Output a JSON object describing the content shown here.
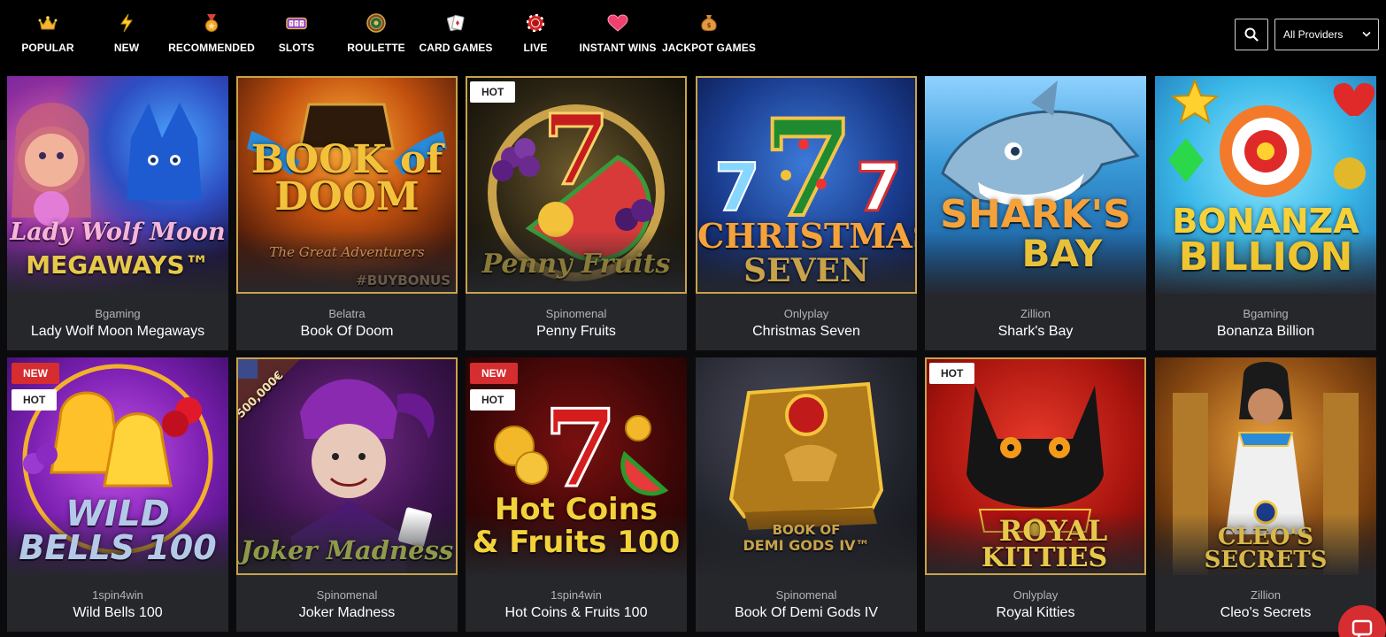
{
  "nav": {
    "items": [
      {
        "label": "POPULAR",
        "icon": "crown-icon"
      },
      {
        "label": "NEW",
        "icon": "lightning-icon"
      },
      {
        "label": "RECOMMENDED",
        "icon": "medal-icon"
      },
      {
        "label": "SLOTS",
        "icon": "slot-machine-icon"
      },
      {
        "label": "ROULETTE",
        "icon": "roulette-icon"
      },
      {
        "label": "CARD GAMES",
        "icon": "cards-icon"
      },
      {
        "label": "LIVE",
        "icon": "chip-icon"
      },
      {
        "label": "INSTANT WINS",
        "icon": "heart-icon"
      },
      {
        "label": "JACKPOT GAMES",
        "icon": "money-bag-icon"
      }
    ]
  },
  "filter": {
    "provider_selected": "All Providers"
  },
  "games": [
    {
      "provider": "Bgaming",
      "title": "Lady Wolf Moon Megaways",
      "art_line1": "Lady Wolf Moon",
      "art_line2": "MEGAWAYS™",
      "badges": []
    },
    {
      "provider": "Belatra",
      "title": "Book Of Doom",
      "art_line1": "BOOK of DOOM",
      "art_line2": "The Great Adventurers",
      "art_line3": "#BUYBONUS",
      "badges": []
    },
    {
      "provider": "Spinomenal",
      "title": "Penny Fruits",
      "art_line1": "Penny Fruits",
      "badges": [
        "HOT"
      ]
    },
    {
      "provider": "Onlyplay",
      "title": "Christmas Seven",
      "art_line1": "CHRISTMAS",
      "art_line2": "SEVEN",
      "badges": []
    },
    {
      "provider": "Zillion",
      "title": "Shark's Bay",
      "art_line1": "SHARK'S",
      "art_line2": "BAY",
      "badges": []
    },
    {
      "provider": "Bgaming",
      "title": "Bonanza Billion",
      "art_line1": "BONANZA",
      "art_line2": "BILLION",
      "badges": []
    },
    {
      "provider": "1spin4win",
      "title": "Wild Bells 100",
      "art_line1": "WILD",
      "art_line2": "BELLS 100",
      "badges": [
        "NEW",
        "HOT"
      ]
    },
    {
      "provider": "Spinomenal",
      "title": "Joker Madness",
      "art_line1": "Joker Madness",
      "art_line2": "500,000€",
      "badges": []
    },
    {
      "provider": "1spin4win",
      "title": "Hot Coins & Fruits 100",
      "art_line1": "Hot Coins",
      "art_line2": "& Fruits 100",
      "badges": [
        "NEW",
        "HOT"
      ]
    },
    {
      "provider": "Spinomenal",
      "title": "Book Of Demi Gods IV",
      "art_line1": "BOOK OF",
      "art_line2": "DEMI GODS IV™",
      "badges": []
    },
    {
      "provider": "Onlyplay",
      "title": "Royal Kitties",
      "art_line1": "ROYAL",
      "art_line2": "KITTIES",
      "badges": [
        "HOT"
      ]
    },
    {
      "provider": "Zillion",
      "title": "Cleo's Secrets",
      "art_line1": "CLEO'S SECRETS",
      "badges": []
    }
  ],
  "colors": {
    "card_bg": "#26272b",
    "badge_new": "#d62d30",
    "badge_hot": "#ffffff",
    "gold_frame": "#c9a24a"
  }
}
